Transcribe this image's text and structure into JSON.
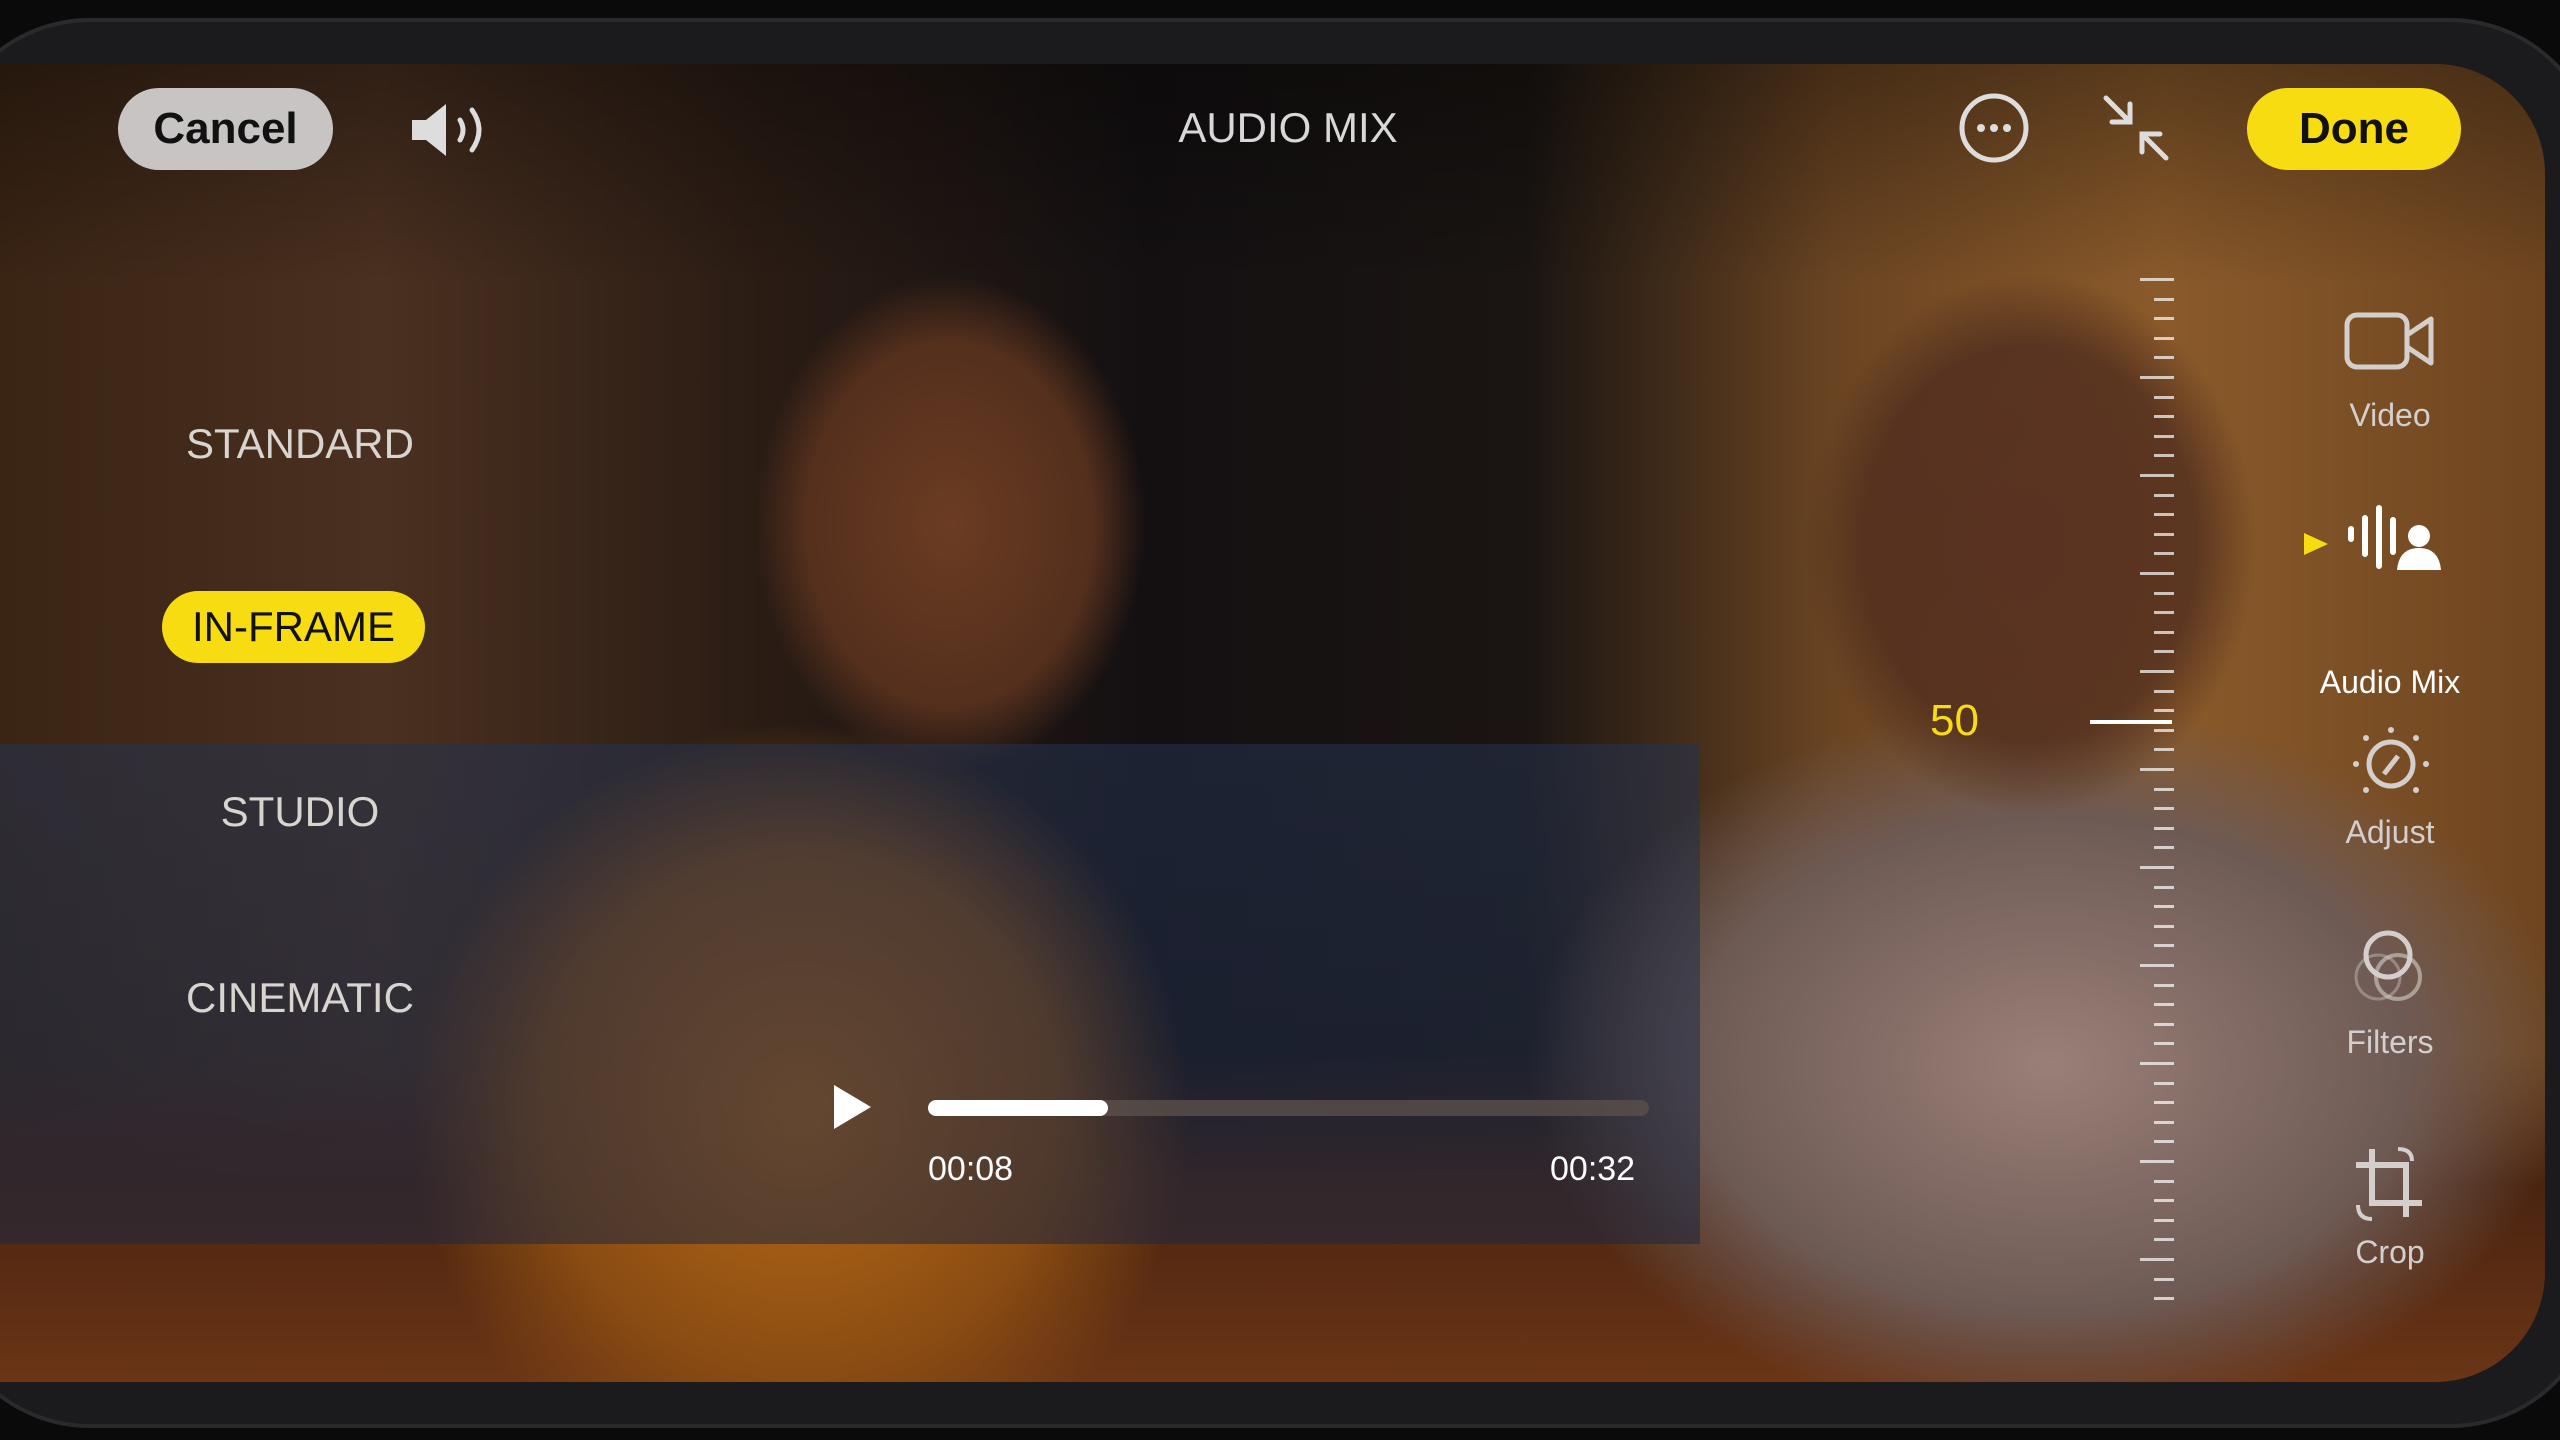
{
  "header": {
    "cancel_label": "Cancel",
    "title": "AUDIO MIX",
    "done_label": "Done",
    "icons": [
      "speaker-icon",
      "more-icon",
      "collapse-icon"
    ]
  },
  "modes": [
    {
      "label": "STANDARD"
    },
    {
      "label": "IN-FRAME",
      "selected": true
    },
    {
      "label": "STUDIO"
    },
    {
      "label": "CINEMATIC"
    }
  ],
  "slider": {
    "value": "50",
    "level": 50
  },
  "sidebar": {
    "items": [
      {
        "label": "Video",
        "icon": "video-camera-icon"
      },
      {
        "label": "Audio Mix",
        "icon": "audio-mix-icon",
        "selected": true
      },
      {
        "label": "Adjust",
        "icon": "adjust-icon"
      },
      {
        "label": "Filters",
        "icon": "filters-icon"
      },
      {
        "label": "Crop",
        "icon": "crop-icon"
      }
    ]
  },
  "playback": {
    "current_time": "00:08",
    "duration": "00:32",
    "progress_percent": 25
  },
  "colors": {
    "accent": "#f7dc12"
  }
}
